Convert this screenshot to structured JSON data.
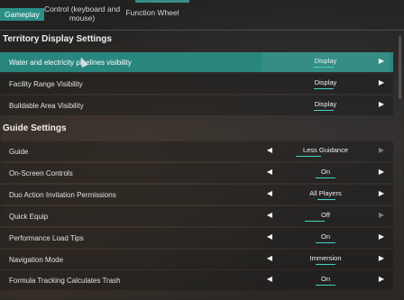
{
  "tabs": [
    {
      "label": "Gameplay",
      "active": true
    },
    {
      "label": "Control (keyboard and mouse)",
      "active": false
    },
    {
      "label": "Function Wheel",
      "active": false
    }
  ],
  "sections": [
    {
      "title": "Territory Display Settings",
      "rows": [
        {
          "label": "Water and electricity pipelines visibility",
          "value": "Display",
          "selected": true
        },
        {
          "label": "Facility Range Visibility",
          "value": "Display",
          "selected": false
        },
        {
          "label": "Buildable Area Visibility",
          "value": "Display",
          "selected": false
        }
      ]
    },
    {
      "title": "Guide Settings",
      "rows": [
        {
          "label": "Guide",
          "value": "Less Guidance"
        },
        {
          "label": "On-Screen Controls",
          "value": "On"
        },
        {
          "label": "Duo Action Invitation Permissions",
          "value": "All Players"
        },
        {
          "label": "Quick Equip",
          "value": "Off"
        },
        {
          "label": "Performance Load Tips",
          "value": "On"
        },
        {
          "label": "Navigation Mode",
          "value": "Immersion"
        },
        {
          "label": "Formula Tracking Calculates Trash",
          "value": "On"
        }
      ]
    }
  ],
  "icons": {
    "left_arrow": "◀",
    "right_arrow": "▶"
  },
  "colors": {
    "accent": "#29867f",
    "underline": "#46d3c6"
  }
}
